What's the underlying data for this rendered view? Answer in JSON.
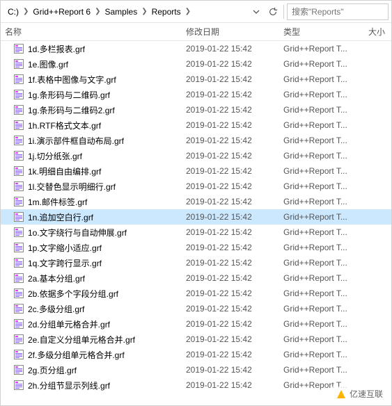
{
  "breadcrumb": {
    "items": [
      "C:)",
      "Grid++Report 6",
      "Samples",
      "Reports"
    ]
  },
  "search": {
    "placeholder": "搜索\"Reports\""
  },
  "columns": {
    "name": "名称",
    "date": "修改日期",
    "type": "类型",
    "size": "大小"
  },
  "selected_index": 11,
  "files": [
    {
      "name": "1d.多栏报表.grf",
      "date": "2019-01-22 15:42",
      "type": "Grid++Report T..."
    },
    {
      "name": "1e.图像.grf",
      "date": "2019-01-22 15:42",
      "type": "Grid++Report T..."
    },
    {
      "name": "1f.表格中图像与文字.grf",
      "date": "2019-01-22 15:42",
      "type": "Grid++Report T..."
    },
    {
      "name": "1g.条形码与二维码.grf",
      "date": "2019-01-22 15:42",
      "type": "Grid++Report T..."
    },
    {
      "name": "1g.条形码与二维码2.grf",
      "date": "2019-01-22 15:42",
      "type": "Grid++Report T..."
    },
    {
      "name": "1h.RTF格式文本.grf",
      "date": "2019-01-22 15:42",
      "type": "Grid++Report T..."
    },
    {
      "name": "1i.演示部件框自动布局.grf",
      "date": "2019-01-22 15:42",
      "type": "Grid++Report T..."
    },
    {
      "name": "1j.切分纸张.grf",
      "date": "2019-01-22 15:42",
      "type": "Grid++Report T..."
    },
    {
      "name": "1k.明细自由编排.grf",
      "date": "2019-01-22 15:42",
      "type": "Grid++Report T..."
    },
    {
      "name": "1l.交替色显示明细行.grf",
      "date": "2019-01-22 15:42",
      "type": "Grid++Report T..."
    },
    {
      "name": "1m.邮件标签.grf",
      "date": "2019-01-22 15:42",
      "type": "Grid++Report T..."
    },
    {
      "name": "1n.追加空白行.grf",
      "date": "2019-01-22 15:42",
      "type": "Grid++Report T..."
    },
    {
      "name": "1o.文字绕行与自动伸展.grf",
      "date": "2019-01-22 15:42",
      "type": "Grid++Report T..."
    },
    {
      "name": "1p.文字缩小适应.grf",
      "date": "2019-01-22 15:42",
      "type": "Grid++Report T..."
    },
    {
      "name": "1q.文字跨行显示.grf",
      "date": "2019-01-22 15:42",
      "type": "Grid++Report T..."
    },
    {
      "name": "2a.基本分组.grf",
      "date": "2019-01-22 15:42",
      "type": "Grid++Report T..."
    },
    {
      "name": "2b.依据多个字段分组.grf",
      "date": "2019-01-22 15:42",
      "type": "Grid++Report T..."
    },
    {
      "name": "2c.多级分组.grf",
      "date": "2019-01-22 15:42",
      "type": "Grid++Report T..."
    },
    {
      "name": "2d.分组单元格合并.grf",
      "date": "2019-01-22 15:42",
      "type": "Grid++Report T..."
    },
    {
      "name": "2e.自定义分组单元格合并.grf",
      "date": "2019-01-22 15:42",
      "type": "Grid++Report T..."
    },
    {
      "name": "2f.多级分组单元格合并.grf",
      "date": "2019-01-22 15:42",
      "type": "Grid++Report T..."
    },
    {
      "name": "2g.页分组.grf",
      "date": "2019-01-22 15:42",
      "type": "Grid++Report T..."
    },
    {
      "name": "2h.分组节显示列线.grf",
      "date": "2019-01-22 15:42",
      "type": "Grid++Report T..."
    }
  ],
  "watermark": {
    "text": "亿速互联"
  }
}
